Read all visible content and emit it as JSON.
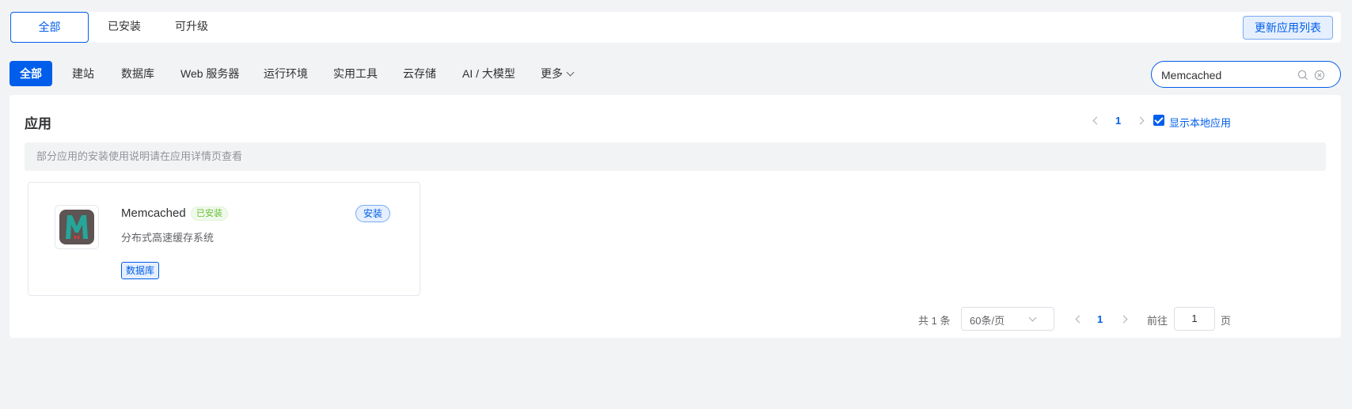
{
  "tabs": [
    {
      "label": "全部",
      "active": true
    },
    {
      "label": "已安装",
      "active": false
    },
    {
      "label": "可升级",
      "active": false
    }
  ],
  "update_button": "更新应用列表",
  "categories": [
    {
      "label": "全部",
      "active": true
    },
    {
      "label": "建站"
    },
    {
      "label": "数据库"
    },
    {
      "label": "Web 服务器"
    },
    {
      "label": "运行环境"
    },
    {
      "label": "实用工具"
    },
    {
      "label": "云存储"
    },
    {
      "label": "AI / 大模型"
    },
    {
      "label": "更多"
    }
  ],
  "search": {
    "value": "Memcached",
    "icon": "search-icon",
    "clear_icon": "clear-icon"
  },
  "panel": {
    "title": "应用",
    "top_page": "1",
    "show_local_label": "显示本地应用",
    "show_local_checked": true,
    "notice": "部分应用的安装使用说明请在应用详情页查看"
  },
  "app": {
    "name": "Memcached",
    "installed_badge": "已安装",
    "install_button": "安装",
    "description": "分布式高速缓存系统",
    "tag": "数据库"
  },
  "pagination": {
    "total": "共 1 条",
    "page_size": "60条/页",
    "current_page": "1",
    "goto_label": "前往",
    "goto_value": "1",
    "page_suffix": "页"
  },
  "colors": {
    "accent": "#005eeb",
    "success": "#67c23a",
    "background": "#f2f3f5"
  }
}
